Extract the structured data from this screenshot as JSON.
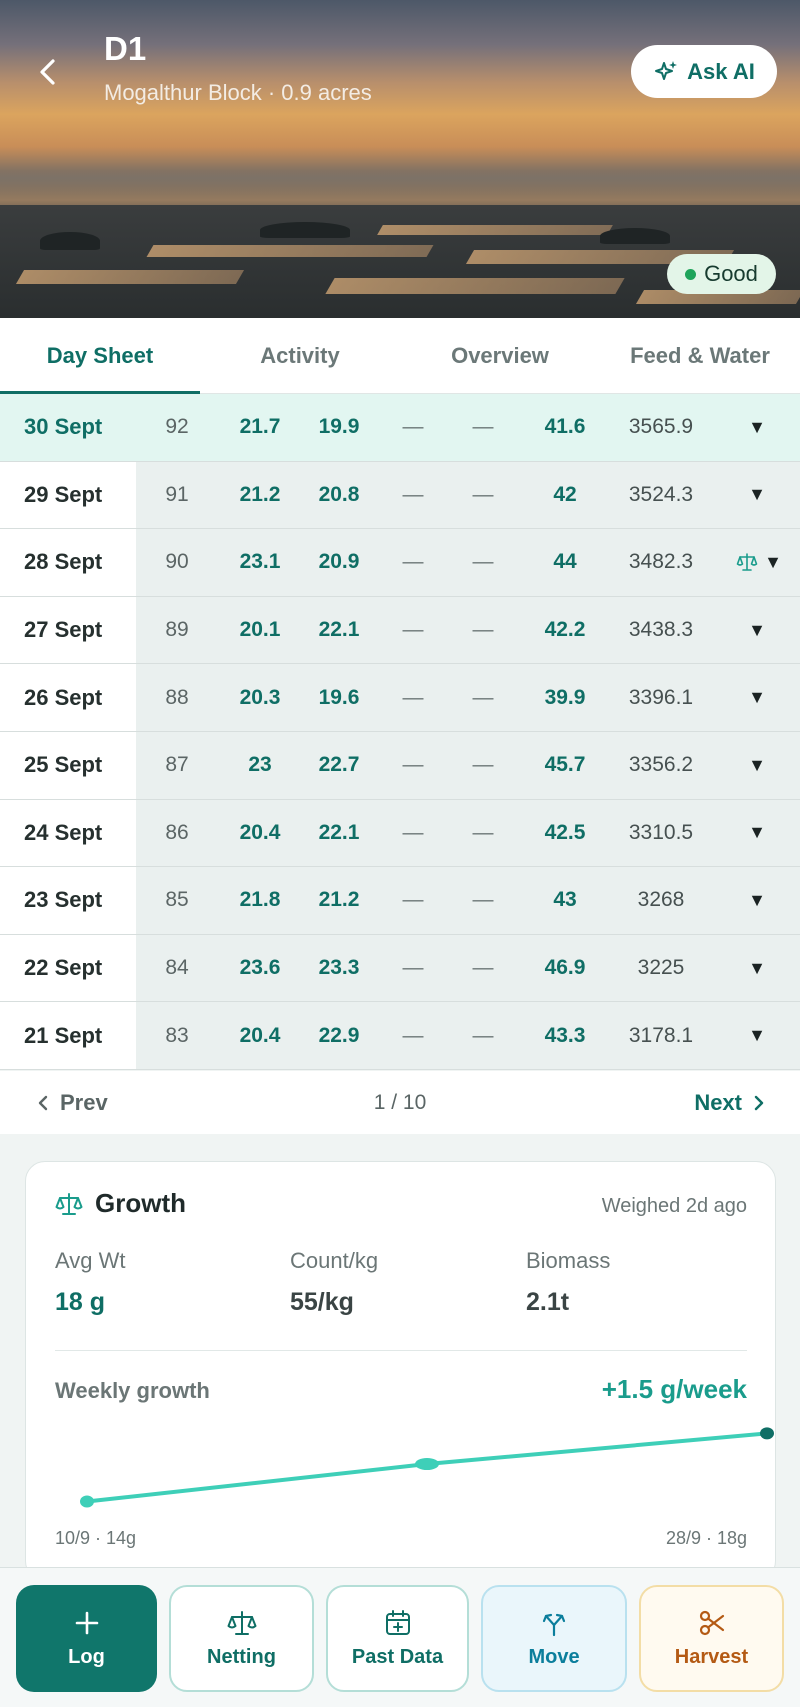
{
  "header": {
    "title": "D1",
    "subtitle": "Mogalthur Block · 0.9 acres",
    "ask_ai_label": "Ask AI",
    "status": "Good",
    "status_color": "#1ea45a"
  },
  "tabs": [
    {
      "label": "Day Sheet",
      "active": true
    },
    {
      "label": "Activity",
      "active": false
    },
    {
      "label": "Overview",
      "active": false
    },
    {
      "label": "Feed & Water",
      "active": false
    }
  ],
  "rows": [
    {
      "date": "30 Sept",
      "doc": "92",
      "t1": "21.7",
      "t2": "19.9",
      "d1": "—",
      "d2": "—",
      "feed": "41.6",
      "total": "3565.9",
      "arrow": "▼"
    },
    {
      "date": "29 Sept",
      "doc": "91",
      "t1": "21.2",
      "t2": "20.8",
      "d1": "—",
      "d2": "—",
      "feed": "42",
      "total": "3524.3",
      "arrow": "▼"
    },
    {
      "date": "28 Sept",
      "doc": "90",
      "t1": "23.1",
      "t2": "20.9",
      "d1": "—",
      "d2": "—",
      "feed": "44",
      "total": "3482.3",
      "arrow": "▼"
    },
    {
      "date": "27 Sept",
      "doc": "89",
      "t1": "20.1",
      "t2": "22.1",
      "d1": "—",
      "d2": "—",
      "feed": "42.2",
      "total": "3438.3",
      "arrow": "▼"
    },
    {
      "date": "26 Sept",
      "doc": "88",
      "t1": "20.3",
      "t2": "19.6",
      "d1": "—",
      "d2": "—",
      "feed": "39.9",
      "total": "3396.1",
      "arrow": "▼"
    },
    {
      "date": "25 Sept",
      "doc": "87",
      "t1": "23",
      "t2": "22.7",
      "d1": "—",
      "d2": "—",
      "feed": "45.7",
      "total": "3356.2",
      "arrow": "▼"
    },
    {
      "date": "24 Sept",
      "doc": "86",
      "t1": "20.4",
      "t2": "22.1",
      "d1": "—",
      "d2": "—",
      "feed": "42.5",
      "total": "3310.5",
      "arrow": "▼"
    },
    {
      "date": "23 Sept",
      "doc": "85",
      "t1": "21.8",
      "t2": "21.2",
      "d1": "—",
      "d2": "—",
      "feed": "43",
      "total": "3268",
      "arrow": "▼"
    },
    {
      "date": "22 Sept",
      "doc": "84",
      "t1": "23.6",
      "t2": "23.3",
      "d1": "—",
      "d2": "—",
      "feed": "46.9",
      "total": "3225",
      "arrow": "▼"
    },
    {
      "date": "21 Sept",
      "doc": "83",
      "t1": "20.4",
      "t2": "22.9",
      "d1": "—",
      "d2": "—",
      "feed": "43.3",
      "total": "3178.1",
      "arrow": "▼"
    }
  ],
  "pagination": {
    "prev_label": "Prev",
    "page": "1 / 10",
    "next_label": "Next"
  },
  "growth": {
    "title": "Growth",
    "weighed": "Weighed 2d ago",
    "avg_wt_label": "Avg Wt",
    "avg_wt_value": "18 g",
    "count_label": "Count/kg",
    "count_value": "55/kg",
    "biomass_label": "Biomass",
    "biomass_value": "2.1t",
    "weekly_label": "Weekly growth",
    "weekly_value": "+1.5 g/week",
    "start_label": "10/9 · 14g",
    "end_label": "28/9 · 18g"
  },
  "chart_data": {
    "type": "line",
    "x": [
      "10/9",
      "19/9",
      "28/9"
    ],
    "series": [
      {
        "values": [
          14,
          16.2,
          18
        ]
      }
    ],
    "ylim": [
      13.5,
      18.2
    ],
    "grid": false,
    "line_color": "#3ecfb8"
  },
  "actions": {
    "log": "Log",
    "netting": "Netting",
    "past_data": "Past Data",
    "move": "Move",
    "harvest": "Harvest"
  },
  "colors": {
    "primary": "#0f6e65",
    "accent": "#1a9c8c",
    "move": "#0b7e9c",
    "harvest": "#b45a14"
  }
}
